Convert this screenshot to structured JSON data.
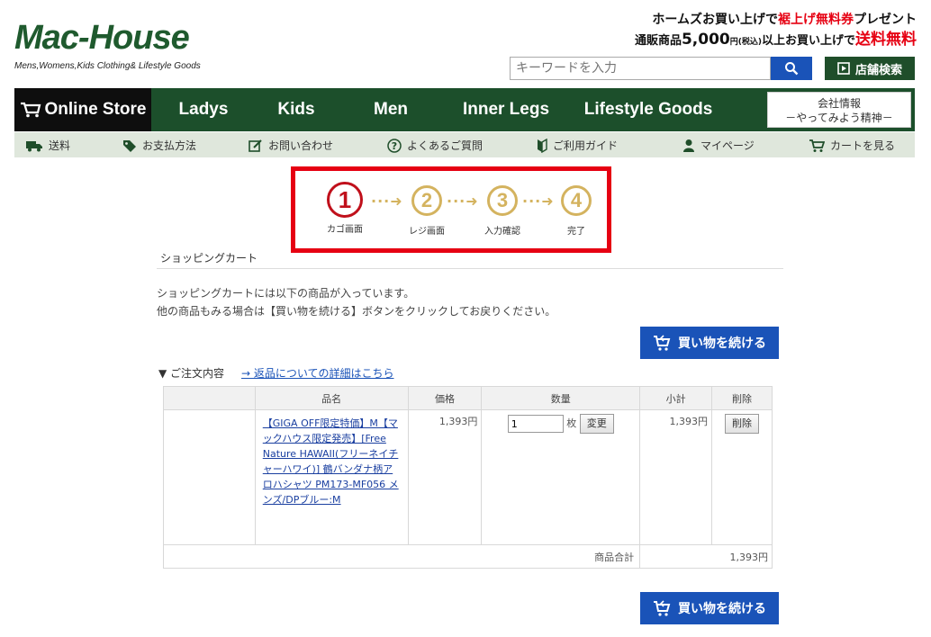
{
  "header": {
    "logo_main": "Mac-House",
    "logo_sub": "Mens,Womens,Kids Clothing& Lifestyle Goods",
    "promo_line1_pre": "ホームズお買い上げで",
    "promo_line1_red": "裾上げ無料券",
    "promo_line1_post": "プレゼント",
    "promo_line2_pre": "通販商品",
    "promo_line2_amount": "5,000",
    "promo_line2_unit": "円(税込)",
    "promo_line2_mid": "以上お買い上げで",
    "promo_line2_red": "送料無料",
    "search_placeholder": "キーワードを入力",
    "store_search_label": "店舗検索"
  },
  "main_nav": {
    "online_store": "Online Store",
    "items": [
      "Ladys",
      "Kids",
      "Men",
      "Inner Legs",
      "Lifestyle Goods"
    ],
    "corp_line1": "会社情報",
    "corp_line2": "－やってみよう精神－"
  },
  "sub_nav": {
    "items": [
      "送料",
      "お支払方法",
      "お問い合わせ",
      "よくあるご質問",
      "ご利用ガイド",
      "マイページ",
      "カートを見る"
    ]
  },
  "steps": {
    "items": [
      {
        "num": "1",
        "label": "カゴ画面"
      },
      {
        "num": "2",
        "label": "レジ画面"
      },
      {
        "num": "3",
        "label": "入力確認"
      },
      {
        "num": "4",
        "label": "完了"
      }
    ],
    "arrow": "···➜"
  },
  "content": {
    "section_title": "ショッピングカート",
    "intro_line1": "ショッピングカートには以下の商品が入っています。",
    "intro_line2": "他の商品もみる場合は【買い物を続ける】ボタンをクリックしてお戻りください。",
    "continue_label": "買い物を続ける",
    "order_label": "▼ ご注文内容",
    "detail_link": "→ 返品についての詳細はこちら"
  },
  "cart": {
    "headers": [
      "品名",
      "価格",
      "数量",
      "小計",
      "削除"
    ],
    "items": [
      {
        "name": "【GIGA OFF限定特価】M【マックハウス限定発売】[Free Nature HAWAII(フリーネイチャーハワイ)] 鶴バンダナ柄アロハシャツ PM173-MF056 メンズ/DPブルー:M",
        "price": "1,393円",
        "qty": "1",
        "qty_unit": "枚",
        "change_label": "変更",
        "subtotal": "1,393円",
        "delete_label": "削除"
      }
    ],
    "total_label": "商品合計",
    "total_value": "1,393円"
  },
  "colors": {
    "brand_green": "#1c4f2b",
    "accent_blue": "#1a53b8",
    "alert_red": "#e60012",
    "step_gold": "#d4b35f"
  }
}
